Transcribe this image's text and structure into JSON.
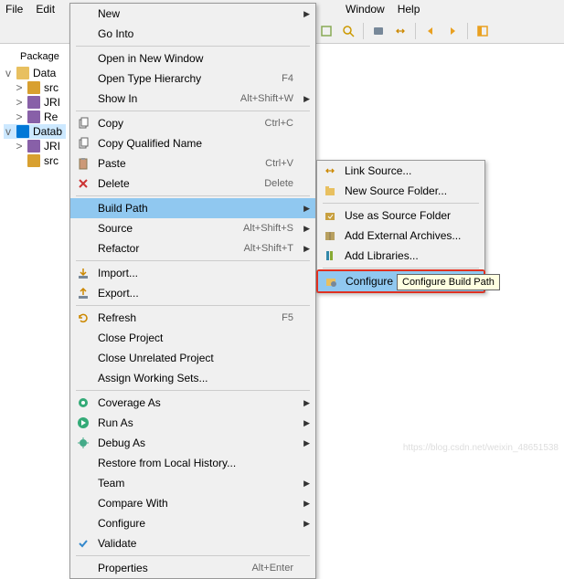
{
  "menubar": [
    "File",
    "Edit",
    "Window",
    "Help"
  ],
  "sidebar": {
    "title": "Package",
    "items": [
      {
        "tw": "v",
        "label": "Data",
        "type": "folder"
      },
      {
        "tw": ">",
        "label": "src",
        "type": "pkg",
        "indent": 1
      },
      {
        "tw": ">",
        "label": "JRI",
        "type": "jre",
        "indent": 1
      },
      {
        "tw": ">",
        "label": "Re",
        "type": "jre",
        "indent": 1
      },
      {
        "tw": "v",
        "label": "Datab",
        "type": "folder",
        "selected": true
      },
      {
        "tw": ">",
        "label": "JRI",
        "type": "jre",
        "indent": 1
      },
      {
        "tw": "",
        "label": "src",
        "type": "pkg",
        "indent": 1
      }
    ]
  },
  "context_menu": [
    {
      "label": "New",
      "arrow": true
    },
    {
      "label": "Go Into"
    },
    {
      "sep": true
    },
    {
      "label": "Open in New Window"
    },
    {
      "label": "Open Type Hierarchy",
      "shortcut": "F4"
    },
    {
      "label": "Show In",
      "shortcut": "Alt+Shift+W",
      "arrow": true
    },
    {
      "sep": true
    },
    {
      "label": "Copy",
      "icon": "copy",
      "shortcut": "Ctrl+C"
    },
    {
      "label": "Copy Qualified Name",
      "icon": "copy"
    },
    {
      "label": "Paste",
      "icon": "paste",
      "shortcut": "Ctrl+V"
    },
    {
      "label": "Delete",
      "icon": "delete",
      "shortcut": "Delete"
    },
    {
      "sep": true
    },
    {
      "label": "Build Path",
      "arrow": true,
      "highlight": true
    },
    {
      "label": "Source",
      "shortcut": "Alt+Shift+S",
      "arrow": true
    },
    {
      "label": "Refactor",
      "shortcut": "Alt+Shift+T",
      "arrow": true
    },
    {
      "sep": true
    },
    {
      "label": "Import...",
      "icon": "import"
    },
    {
      "label": "Export...",
      "icon": "export"
    },
    {
      "sep": true
    },
    {
      "label": "Refresh",
      "icon": "refresh",
      "shortcut": "F5"
    },
    {
      "label": "Close Project"
    },
    {
      "label": "Close Unrelated Project"
    },
    {
      "label": "Assign Working Sets..."
    },
    {
      "sep": true
    },
    {
      "label": "Coverage As",
      "icon": "coverage",
      "arrow": true
    },
    {
      "label": "Run As",
      "icon": "run",
      "arrow": true
    },
    {
      "label": "Debug As",
      "icon": "debug",
      "arrow": true
    },
    {
      "label": "Restore from Local History..."
    },
    {
      "label": "Team",
      "arrow": true
    },
    {
      "label": "Compare With",
      "arrow": true
    },
    {
      "label": "Configure",
      "arrow": true
    },
    {
      "label": "Validate",
      "icon": "validate"
    },
    {
      "sep": true
    },
    {
      "label": "Properties",
      "shortcut": "Alt+Enter"
    }
  ],
  "sub_menu": [
    {
      "label": "Link Source...",
      "icon": "link"
    },
    {
      "label": "New Source Folder...",
      "icon": "new-folder"
    },
    {
      "sep": true
    },
    {
      "label": "Use as Source Folder",
      "icon": "use-folder"
    },
    {
      "label": "Add External Archives...",
      "icon": "archive"
    },
    {
      "label": "Add Libraries...",
      "icon": "library"
    },
    {
      "sep": true
    },
    {
      "label": "Configure Build Path...",
      "icon": "configure",
      "highlight": true,
      "boxed": true
    }
  ],
  "tooltip": "Configure Build Path",
  "watermark": "https://blog.csdn.net/weixin_48651538"
}
